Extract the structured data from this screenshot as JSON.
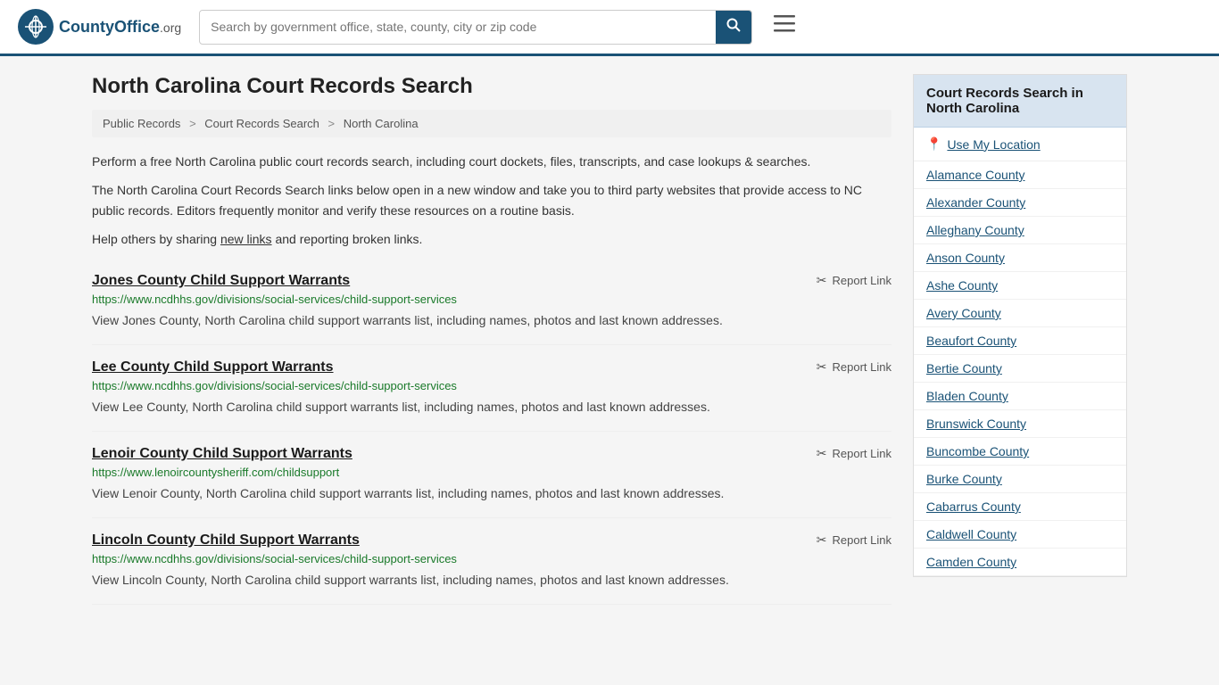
{
  "header": {
    "logo_text": "CountyOffice",
    "logo_suffix": ".org",
    "search_placeholder": "Search by government office, state, county, city or zip code",
    "search_value": ""
  },
  "page": {
    "title": "North Carolina Court Records Search",
    "breadcrumb": [
      {
        "label": "Public Records",
        "href": "#"
      },
      {
        "label": "Court Records Search",
        "href": "#"
      },
      {
        "label": "North Carolina",
        "href": "#"
      }
    ],
    "description1": "Perform a free North Carolina public court records search, including court dockets, files, transcripts, and case lookups & searches.",
    "description2": "The North Carolina Court Records Search links below open in a new window and take you to third party websites that provide access to NC public records. Editors frequently monitor and verify these resources on a routine basis.",
    "description3_prefix": "Help others by sharing ",
    "new_links_label": "new links",
    "description3_suffix": " and reporting broken links."
  },
  "results": [
    {
      "title": "Jones County Child Support Warrants",
      "url": "https://www.ncdhhs.gov/divisions/social-services/child-support-services",
      "description": "View Jones County, North Carolina child support warrants list, including names, photos and last known addresses.",
      "report_label": "Report Link"
    },
    {
      "title": "Lee County Child Support Warrants",
      "url": "https://www.ncdhhs.gov/divisions/social-services/child-support-services",
      "description": "View Lee County, North Carolina child support warrants list, including names, photos and last known addresses.",
      "report_label": "Report Link"
    },
    {
      "title": "Lenoir County Child Support Warrants",
      "url": "https://www.lenoircountysheriff.com/childsupport",
      "description": "View Lenoir County, North Carolina child support warrants list, including names, photos and last known addresses.",
      "report_label": "Report Link"
    },
    {
      "title": "Lincoln County Child Support Warrants",
      "url": "https://www.ncdhhs.gov/divisions/social-services/child-support-services",
      "description": "View Lincoln County, North Carolina child support warrants list, including names, photos and last known addresses.",
      "report_label": "Report Link"
    }
  ],
  "sidebar": {
    "title": "Court Records Search in North Carolina",
    "use_location_label": "Use My Location",
    "counties": [
      "Alamance County",
      "Alexander County",
      "Alleghany County",
      "Anson County",
      "Ashe County",
      "Avery County",
      "Beaufort County",
      "Bertie County",
      "Bladen County",
      "Brunswick County",
      "Buncombe County",
      "Burke County",
      "Cabarrus County",
      "Caldwell County",
      "Camden County"
    ]
  }
}
